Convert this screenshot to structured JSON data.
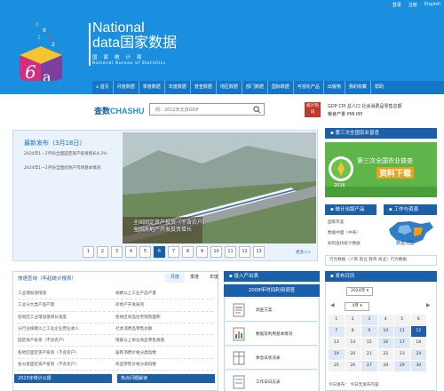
{
  "toplinks": [
    "登录",
    "注册",
    "English"
  ],
  "brand": {
    "line1": "National",
    "line2": "data国家数据",
    "line3": "国家统计局",
    "line4": "National Bureau of Statistics"
  },
  "nav": [
    "首页",
    "月度数据",
    "季度数据",
    "年度数据",
    "普查数据",
    "地区数据",
    "部门数据",
    "国际数据",
    "可视化产品",
    "出版物",
    "我的收藏",
    "帮助"
  ],
  "search": {
    "logo_cha": "查数",
    "logo_chashu": "CHASHU",
    "placeholder": "例：2012年北京GDP"
  },
  "hot": {
    "badge": "统计热词",
    "links_row1": "GDP  CPI  总人口  社会消费品零售总额",
    "links_row2": "粮食产量  PMI  PPI"
  },
  "release": {
    "title": "最新发布（3月18日）",
    "item1": "2024年1—2月份全国固定资产投资增长4.2%",
    "item2": "2024年1—2月份全国房地产市场基本情况",
    "caption1": "全国固定资产投资（不含农户）",
    "caption2": "全国房地产开发投资增长",
    "pages": [
      "1",
      "2",
      "3",
      "4",
      "5",
      "6",
      "7",
      "8",
      "9",
      "10",
      "11",
      "12",
      "13"
    ],
    "active_page": "6",
    "more": "更多>>"
  },
  "census": {
    "head": "第三次全国农业普查",
    "banner_title": "第三次全国农业普查",
    "banner_sub": "资料下载",
    "year": "2016"
  },
  "publications": {
    "head": "统计出版产品",
    "work_head": "工作与资源",
    "links": [
      "国家年鉴",
      "数据中国（中英）",
      "如何查找统计数据"
    ],
    "map_label": "数据地图"
  },
  "quick_row": "行为数据（人民 就业 教育 商业）行为数据",
  "quick": {
    "title": "快速查询（年起统计报表）",
    "tabs": [
      "月度",
      "季度",
      "年度"
    ],
    "active_tab": "月度",
    "rows": [
      [
        "工业增加值增速",
        "规模以上工业产品产量"
      ],
      [
        "工业分大类产品产量",
        "房地产开发投资"
      ],
      [
        "各地区工业增加值增长速度",
        "各地区商品住宅销售面积"
      ],
      [
        "分行业规模以上工业企业营业收入",
        "社会消费品零售总额"
      ],
      [
        "固定资产投资（不含农户）",
        "限额以上单位商品零售类值"
      ],
      [
        "各地区固定资产投资（不含农户）",
        "居民消费价格分类指数"
      ],
      [
        "各分类固定资产投资（不含农户）",
        "商品零售价格分类指数"
      ]
    ],
    "bar1": "2023年统计公报",
    "bar2": "热点问题解读"
  },
  "products": {
    "head": "投入产出表",
    "sub": "2008年时间利用调查",
    "items": [
      "调查方案",
      "数据及利用基本情况",
      "休息日状况表",
      "工作日日志表"
    ]
  },
  "calendar": {
    "head": "发布日历",
    "year": "2024年",
    "month": "4月",
    "days": [
      "1",
      "2",
      "3",
      "4",
      "5",
      "6",
      "7",
      "8",
      "9",
      "10",
      "11",
      "12",
      "13",
      "14",
      "15",
      "16",
      "17",
      "18",
      "19",
      "20",
      "21",
      "22",
      "23",
      "24",
      "25",
      "26",
      "27",
      "28",
      "29",
      "30"
    ],
    "today": "12",
    "marked": [
      "3",
      "7",
      "9",
      "10",
      "11",
      "16",
      "17",
      "19",
      "24",
      "27",
      "29",
      "30"
    ],
    "footer": "今日发布：  今日无发布内容"
  },
  "colors": {
    "header_blue": "#1a8fe0",
    "nav_blue": "#1576c6",
    "dark_blue": "#1a5fa8",
    "census_green": "#5fb54a"
  }
}
